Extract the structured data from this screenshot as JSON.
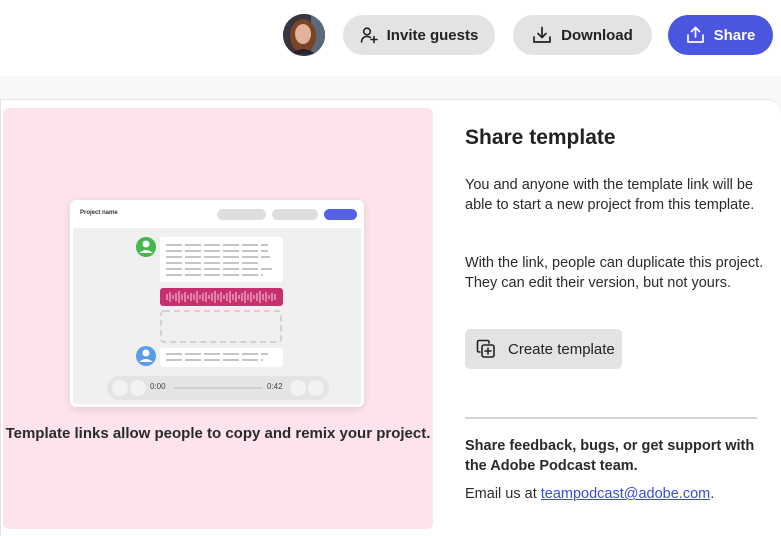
{
  "header": {
    "invite_label": "Invite guests",
    "download_label": "Download",
    "share_label": "Share"
  },
  "preview": {
    "project_name": "Project name",
    "time_start": "0:00",
    "time_end": "0:42",
    "caption": "Template links allow people to copy and remix your project."
  },
  "share_template": {
    "title": "Share template",
    "paragraph1": "You and anyone with the template link will be able to start a new project from this template.",
    "paragraph2": "With the link, people can duplicate this project. They can edit their version, but not yours.",
    "create_label": "Create template"
  },
  "feedback": {
    "text": "Share feedback, bugs, or get support with the Adobe Podcast team.",
    "email_prefix": "Email us at ",
    "email": "teampodcast@adobe.com",
    "email_suffix": "."
  },
  "colors": {
    "accent": "#4a55e0",
    "preview_bg": "#fde4ea",
    "waveform": "#c6306e",
    "speaker1": "#43b74a",
    "speaker2": "#5a9ce8"
  }
}
